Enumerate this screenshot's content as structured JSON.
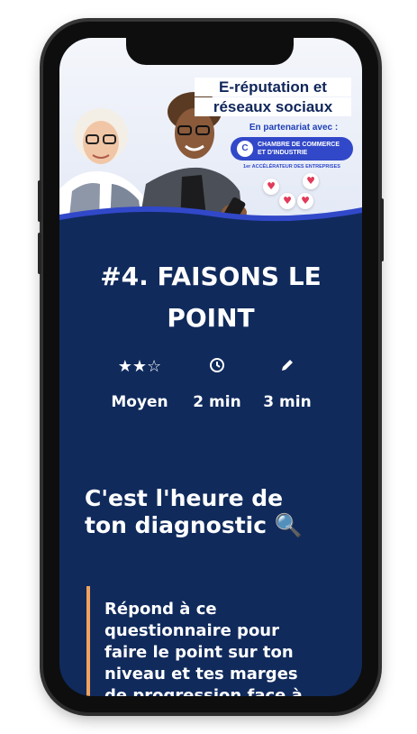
{
  "banner": {
    "title_line1": "E-réputation et",
    "title_line2": "réseaux sociaux",
    "partner_label": "En partenariat avec :",
    "cci_logo": "C",
    "cci_line1": "CHAMBRE DE COMMERCE",
    "cci_line2": "ET D'INDUSTRIE",
    "accelerator_label": "1er ACCÉLÉRATEUR DES ENTREPRISES"
  },
  "lesson": {
    "title_line1": "#4. FAISONS LE",
    "title_line2": "POINT",
    "difficulty_stars": "★★☆",
    "difficulty_rating": 2,
    "difficulty_max": 3,
    "difficulty_label": "Moyen",
    "read_time_icon": "clock-icon",
    "read_time_label": "2 min",
    "exercise_icon": "pencil-icon",
    "exercise_time_label": "3 min"
  },
  "section": {
    "heading_line1": "C'est l'heure de",
    "heading_line2": "ton diagnostic 🔍",
    "quote_lines": [
      "Répond à ce",
      "questionnaire pour",
      "faire le point sur ton",
      "niveau et tes marges",
      "de progression face à"
    ]
  },
  "colors": {
    "screen_background": "#102a5c",
    "brand_blue": "#3148c9",
    "quote_accent": "#f0a35e"
  }
}
